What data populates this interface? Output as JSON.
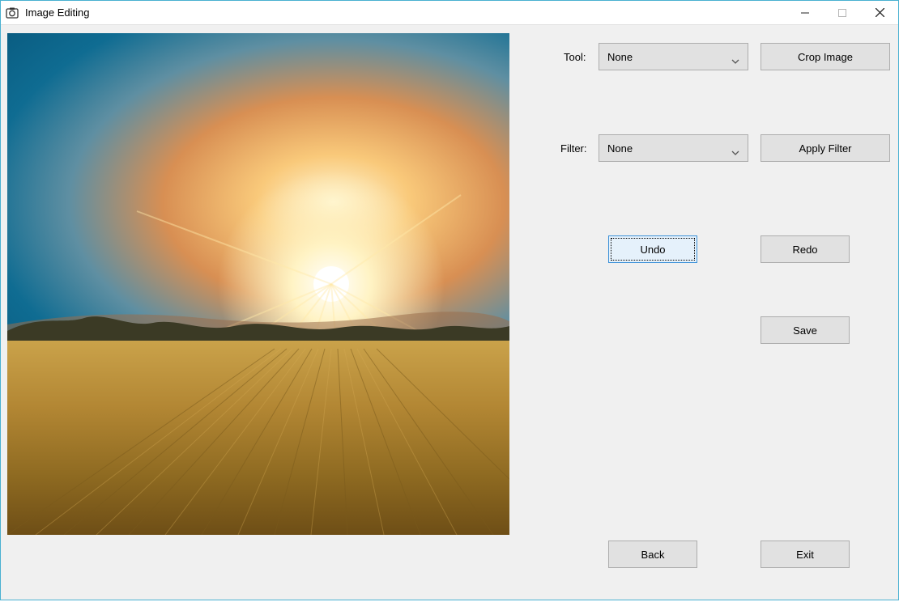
{
  "window": {
    "title": "Image Editing"
  },
  "labels": {
    "tool": "Tool:",
    "filter": "Filter:"
  },
  "dropdowns": {
    "tool_value": "None",
    "filter_value": "None"
  },
  "buttons": {
    "crop": "Crop Image",
    "apply_filter": "Apply Filter",
    "undo": "Undo",
    "redo": "Redo",
    "save": "Save",
    "back": "Back",
    "exit": "Exit"
  }
}
